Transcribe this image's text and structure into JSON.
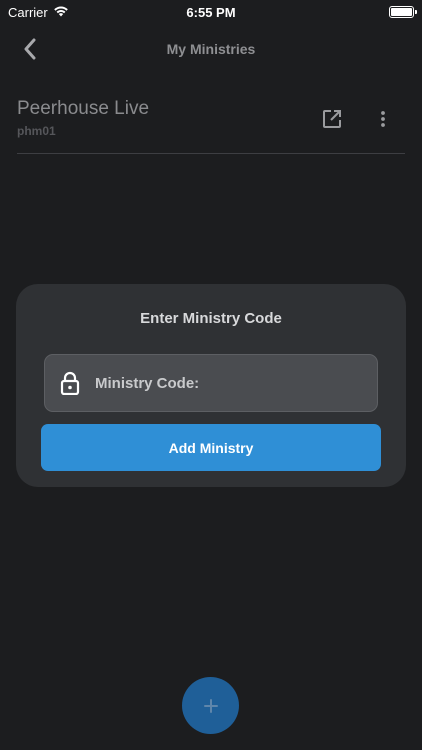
{
  "status_bar": {
    "carrier": "Carrier",
    "time": "6:55 PM"
  },
  "header": {
    "title": "My Ministries"
  },
  "ministries": [
    {
      "name": "Peerhouse Live",
      "code": "phm01"
    }
  ],
  "modal": {
    "title": "Enter Ministry Code",
    "code_placeholder": "Ministry Code:",
    "add_button_label": "Add Ministry"
  },
  "colors": {
    "background": "#1c1d1f",
    "modal": "#2f3134",
    "accent": "#2f8fd6",
    "fab": "#1f5f98"
  }
}
